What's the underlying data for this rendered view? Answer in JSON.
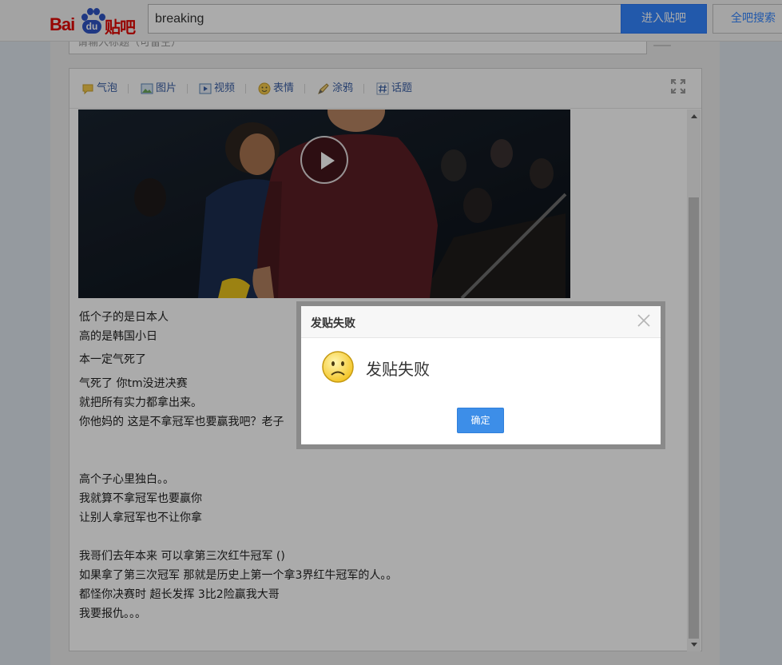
{
  "header": {
    "logo_text_bai": "Bai",
    "logo_text_du": "du",
    "logo_text_tieba": "贴吧",
    "search_value": "breaking",
    "enter_button": "进入贴吧",
    "all_search_button": "全吧搜索"
  },
  "editor": {
    "title_placeholder": "请输入标题（可留空）",
    "toolbar": [
      {
        "label": "气泡",
        "icon": "speech-bubble-icon"
      },
      {
        "label": "图片",
        "icon": "image-icon"
      },
      {
        "label": "视频",
        "icon": "video-icon"
      },
      {
        "label": "表情",
        "icon": "emoji-icon"
      },
      {
        "label": "涂鸦",
        "icon": "doodle-icon"
      },
      {
        "label": "话题",
        "icon": "hashtag-icon"
      }
    ],
    "fullscreen_icon": "fullscreen-icon",
    "video_play_icon": "play-icon",
    "lines": [
      "低个子的是日本人",
      "高的是韩国小日",
      "本一定气死了",
      "气死了 你tm没进决赛",
      "就把所有实力都拿出来。",
      "你他妈的 这是不拿冠军也要赢我吧？老子",
      "高个子心里独白。。",
      "我就算不拿冠军也要赢你",
      "让别人拿冠军也不让你拿",
      "我哥们去年本来 可以拿第三次红牛冠军 ()",
      "如果拿了第三次冠军 那就是历史上第一个拿3界红牛冠军的人。。",
      "都怪你决赛时 超长发挥 3比2险赢我大哥",
      "我要报仇。。。"
    ]
  },
  "dialog": {
    "title": "发贴失败",
    "message": "发贴失败",
    "confirm_button": "确定",
    "icon": "sad-face-icon",
    "close_icon": "close-icon"
  },
  "colors": {
    "brand_red": "#e10602",
    "brand_blue": "#2f54c3",
    "button_blue": "#3385ff",
    "toolbar_link": "#3a5fa5"
  }
}
